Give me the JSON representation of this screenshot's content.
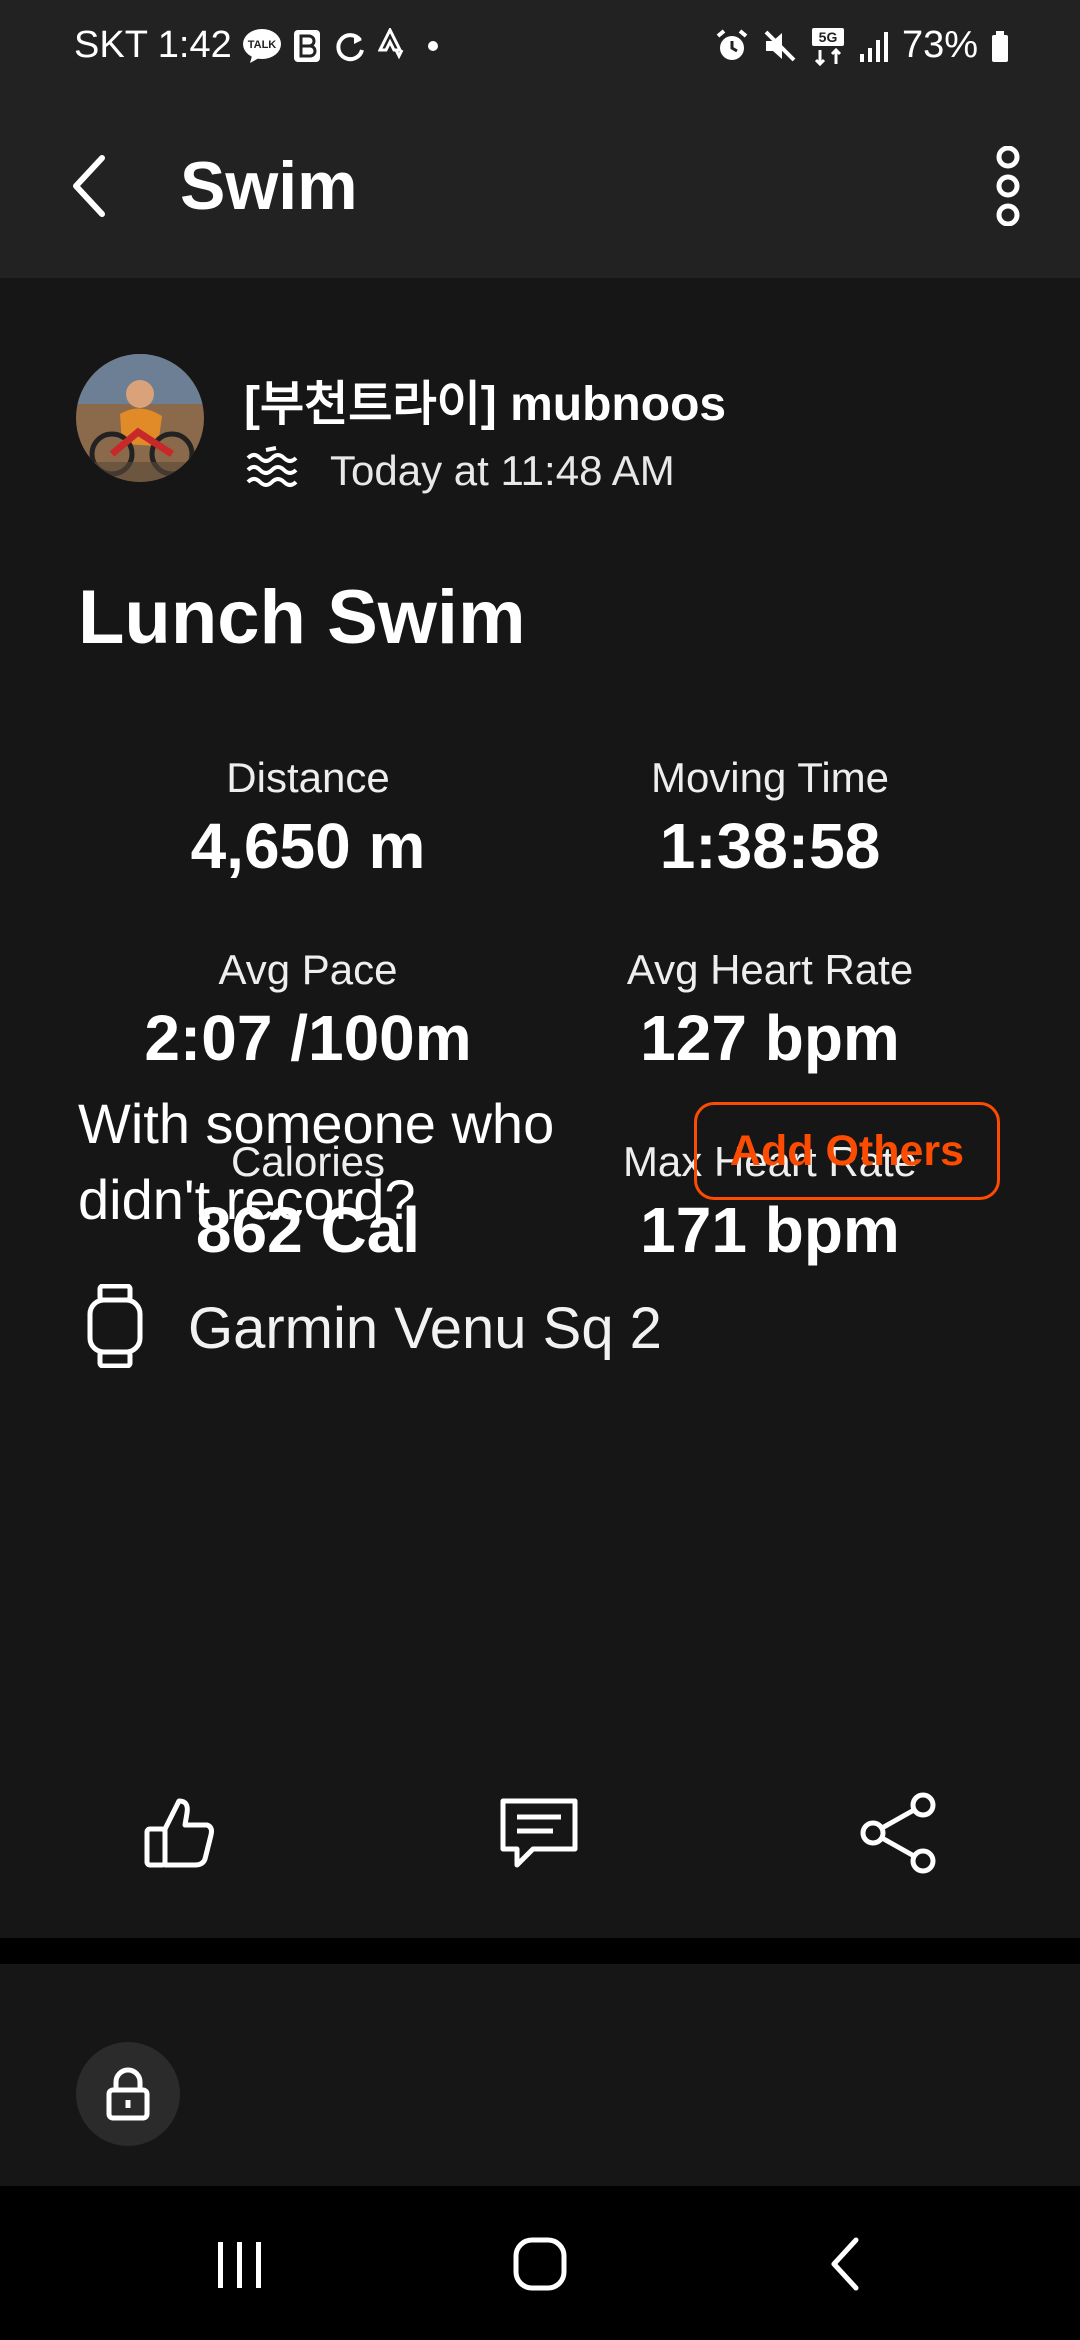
{
  "status_bar": {
    "carrier_time": "SKT 1:42",
    "talk_badge": "TALK",
    "network_badge": "5G",
    "battery": "73%",
    "icons": [
      "talk-icon",
      "b-icon",
      "sync-icon",
      "strava-icon",
      "dot-icon",
      "alarm-icon",
      "mute-icon",
      "5g-icon",
      "signal-icon",
      "battery-icon"
    ]
  },
  "header": {
    "title": "Swim",
    "icons": [
      "back-arrow-icon",
      "more-vertical-icon"
    ]
  },
  "athlete": {
    "name": "[부천트라이] mubnoos",
    "timestamp": "Today at 11:48 AM",
    "activity_icon": "swim-waves-icon"
  },
  "activity": {
    "title": "Lunch Swim",
    "stats": [
      {
        "label": "Distance",
        "value": "4,650 m"
      },
      {
        "label": "Moving Time",
        "value": "1:38:58"
      },
      {
        "label": "Avg Pace",
        "value": "2:07 /100m"
      },
      {
        "label": "Avg Heart Rate",
        "value": "127 bpm"
      },
      {
        "label": "Calories",
        "value": "862 Cal"
      },
      {
        "label": "Max Heart Rate",
        "value": "171 bpm"
      }
    ]
  },
  "group_prompt": {
    "text_line1": "With someone who",
    "text_line2": "didn't record?",
    "button_label": "Add Others",
    "accent_color": "#fc4c02"
  },
  "device": {
    "name": "Garmin Venu Sq 2",
    "icon": "watch-icon"
  },
  "actions": {
    "icons": [
      "thumbs-up-icon",
      "comment-icon",
      "share-icon"
    ]
  },
  "privacy": {
    "icon": "lock-icon"
  },
  "nav_bar": {
    "icons": [
      "recent-apps-icon",
      "home-icon",
      "back-icon"
    ]
  }
}
